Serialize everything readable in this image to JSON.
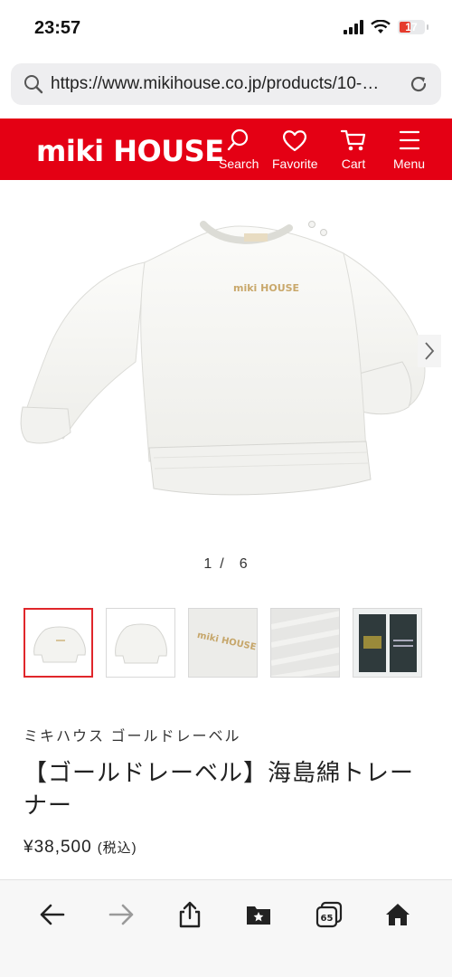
{
  "status": {
    "time": "23:57",
    "battery": "17",
    "signal_icon": "cellular-signal-icon",
    "wifi_icon": "wifi-icon"
  },
  "browser": {
    "url": "https://www.mikihouse.co.jp/products/10-…",
    "search_icon": "search-icon",
    "reload_icon": "reload-icon"
  },
  "site": {
    "logo": "miki HOUSE",
    "brand_color": "#e40014",
    "nav": [
      {
        "label": "Search",
        "icon": "search-icon"
      },
      {
        "label": "Favorite",
        "icon": "heart-icon"
      },
      {
        "label": "Cart",
        "icon": "cart-icon"
      },
      {
        "label": "Menu",
        "icon": "hamburger-icon"
      }
    ]
  },
  "gallery": {
    "current": "1",
    "separator": "/",
    "total": "6",
    "embroidery_text": "miki HOUSE",
    "thumbnails": [
      {
        "name": "thumb-front",
        "active": true
      },
      {
        "name": "thumb-back",
        "active": false
      },
      {
        "name": "thumb-logo-closeup",
        "active": false
      },
      {
        "name": "thumb-fabric",
        "active": false
      },
      {
        "name": "thumb-tag",
        "active": false
      }
    ]
  },
  "product": {
    "brand": "ミキハウス ゴールドレーベル",
    "title": "【ゴールドレーベル】海島綿トレーナー",
    "price": "¥38,500",
    "tax_note": "(税込)"
  },
  "toolbar": {
    "tabs_count": "65",
    "items": [
      "back-icon",
      "forward-icon",
      "share-icon",
      "bookmarks-icon",
      "tabs-icon",
      "home-icon"
    ]
  }
}
